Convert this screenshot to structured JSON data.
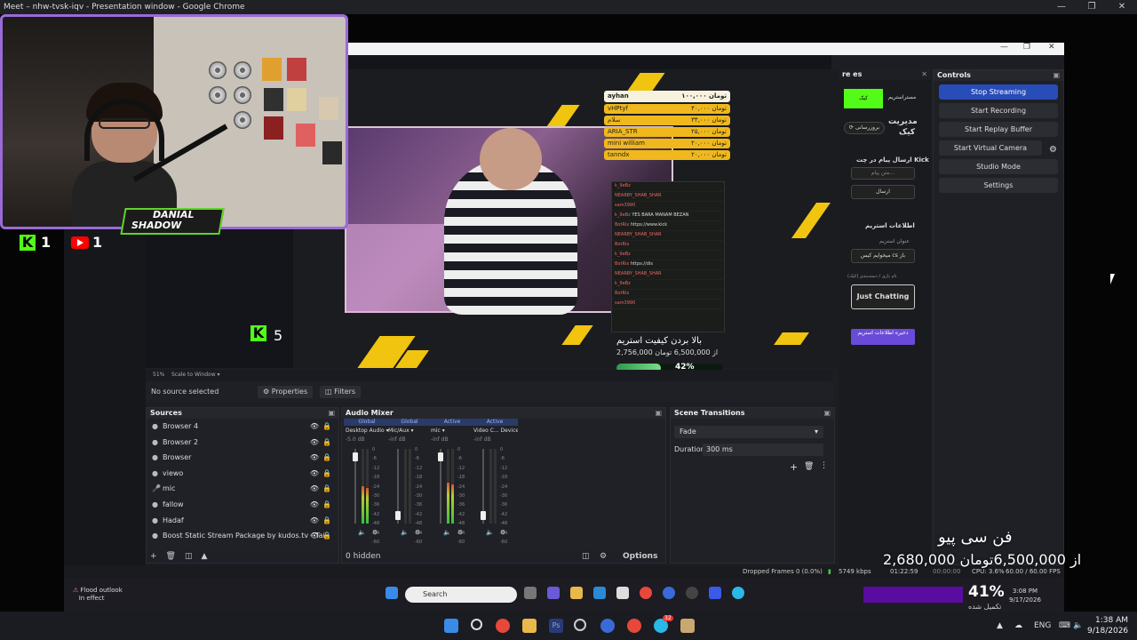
{
  "chrome": {
    "title": "Meet – nhw-tvsk-iqv - Presentation window - Google Chrome"
  },
  "webcam_overlay": {
    "streamer_name_line1": "DANIAL",
    "streamer_name_line2": "SHADOW",
    "kick_count": "1",
    "youtube_count": "1"
  },
  "stream_scene": {
    "kick_viewers": "5",
    "leaderboard": [
      {
        "name": "ayhan",
        "amount": "تومان ۱۰۰,۰۰۰"
      },
      {
        "name": "vHPtyf",
        "amount": "تومان ۴۰,۰۰۰"
      },
      {
        "name": "سلام",
        "amount": "تومان ۳۴,۰۰۰"
      },
      {
        "name": "ARIA_STR",
        "amount": "تومان ۲۵,۰۰۰"
      },
      {
        "name": "mini william",
        "amount": "تومان ۲۰,۰۰۰"
      },
      {
        "name": "tanndx",
        "amount": "تومان ۲۰,۰۰۰"
      }
    ],
    "chat_lines": [
      {
        "user": "k_9eBz",
        "text": ""
      },
      {
        "user": "NEARBY_SHAB_SHAR",
        "text": ""
      },
      {
        "user": "sam3990",
        "text": ""
      },
      {
        "user": "k_9eBz",
        "text": "YES BARA MANAM BEZAN"
      },
      {
        "user": "BotRix",
        "text": "https://www.kick"
      },
      {
        "user": "NEARBY_SHAB_SHAR",
        "text": ""
      },
      {
        "user": "BotRix",
        "text": ""
      },
      {
        "user": "k_9eBz",
        "text": ""
      },
      {
        "user": "BotRix",
        "text": "https://dis"
      },
      {
        "user": "NEARBY_SHAB_SHAR",
        "text": ""
      },
      {
        "user": "k_9eBz",
        "text": ""
      },
      {
        "user": "BotRix",
        "text": ""
      },
      {
        "user": "sam3990",
        "text": ""
      }
    ],
    "goal_title": "بالا بردن کیفیت استریم",
    "goal_amount": "2,756,000 از 6,500,000 تومان",
    "goal_fraction": 0.42,
    "goal_pct": "42%"
  },
  "preview_bar": {
    "zoom": "51%",
    "mode": "Scale to Window"
  },
  "props_bar": {
    "no_source": "No source selected",
    "properties": "Properties",
    "filters": "Filters"
  },
  "sources": {
    "title": "Sources",
    "items": [
      {
        "icon": "globe-icon",
        "name": "Browser 4"
      },
      {
        "icon": "globe-icon",
        "name": "Browser 2"
      },
      {
        "icon": "globe-icon",
        "name": "Browser"
      },
      {
        "icon": "globe-icon",
        "name": "viewo"
      },
      {
        "icon": "mic-icon",
        "name": "mic"
      },
      {
        "icon": "globe-icon",
        "name": "fallow"
      },
      {
        "icon": "globe-icon",
        "name": "Hadaf"
      },
      {
        "icon": "globe-icon",
        "name": "Boost Static Stream Package by kudos.tv - Tai"
      }
    ]
  },
  "mixer": {
    "title": "Audio Mixer",
    "hidden": "0 hidden",
    "options": "Options",
    "channels": [
      {
        "tag": "Global",
        "name": "Desktop Audio",
        "db": "-5.0 dB",
        "level": 0.5
      },
      {
        "tag": "Global",
        "name": "Mic/Aux",
        "db": "-inf dB",
        "level": 0.0
      },
      {
        "tag": "Active",
        "name": "mic",
        "db": "-inf dB",
        "level": 0.55
      },
      {
        "tag": "Active",
        "name": "Video C... Device",
        "db": "-inf dB",
        "level": 0.0
      }
    ],
    "scale": [
      "0",
      "-6",
      "-12",
      "-18",
      "-24",
      "-30",
      "-36",
      "-42",
      "-48",
      "-54",
      "-60"
    ]
  },
  "transitions": {
    "title": "Scene Transitions",
    "type": "Fade",
    "duration_label": "Duration",
    "duration": "300 ms"
  },
  "kick_panel": {
    "title": "re es",
    "stream_label": "مستراستریم",
    "green_btn": "کیک",
    "manage_line1": "مدیریت",
    "manage_line2": "کیک",
    "refresh_btn": "بروزرسانی",
    "chat_title": "ارسال پیام در چت Kick",
    "chat_placeholder": "متن پیام...",
    "send_btn": "ارسال",
    "info_title": "اطلاعات استریم",
    "stream_title_label": "عنوان استریم",
    "stream_title_value": "میخوایم کیس cs باز",
    "category_label": "نام بازی / دسته‌بندی (کیک)",
    "category_value": "Just Chatting",
    "save_btn": "ذخیره اطلاعات استریم"
  },
  "controls": {
    "title": "Controls",
    "buttons": [
      "Stop Streaming",
      "Start Recording",
      "Start Replay Buffer",
      "Start Virtual Camera",
      "Studio Mode",
      "Settings"
    ]
  },
  "statusbar": {
    "dropped": "Dropped Frames 0 (0.0%)",
    "kbps": "5749 kbps",
    "time1": "01:22:59",
    "time2": "00:00:00",
    "cpu": "CPU: 3.6%",
    "fps": "60.00 / 60.00 FPS"
  },
  "remote_taskbar": {
    "weather_line1": "Flood outlook",
    "weather_line2": "In effect",
    "search": "Search",
    "time": "3:08 PM",
    "date": "9/17/2026"
  },
  "big_goal": {
    "line1": "فن سی پیو",
    "line2": "2,680,000 از 6,500,000تومان",
    "pct": "41%",
    "fraction": 0.41,
    "sub": "تکمیل شده"
  },
  "taskbar": {
    "lang": "ENG",
    "time": "1:38 AM",
    "date": "9/18/2026",
    "badge": "32"
  },
  "colors": {
    "kick_green": "#53fc18",
    "obs_blue": "#284cb8",
    "accent_yellow": "#f1c40f",
    "purple": "#6a4bd8"
  }
}
